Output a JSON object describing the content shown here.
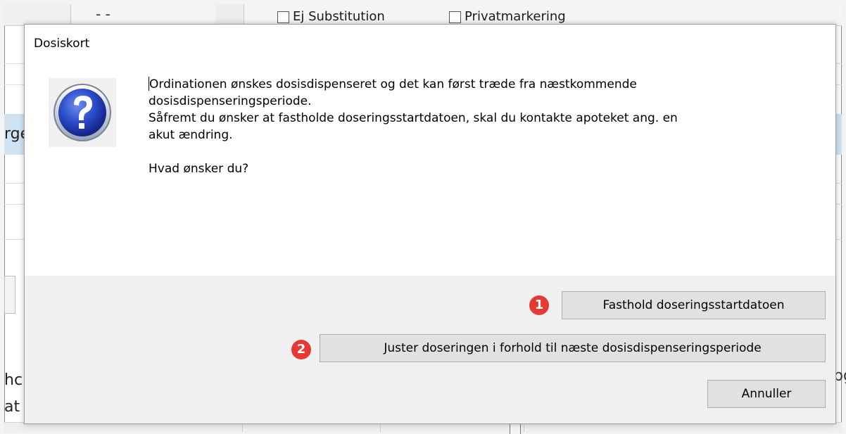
{
  "background": {
    "checkboxes": [
      {
        "label": "Ej Substitution"
      },
      {
        "label": "Privatmarkering"
      }
    ],
    "top_dash": "- -",
    "left_fragments": [
      "rge",
      "hc",
      "at"
    ],
    "right_fragment": "pg"
  },
  "dialog": {
    "title": "Dosiskort",
    "icon": "question-icon",
    "message_lines": [
      "Ordinationen ønskes dosisdispenseret og det kan først træde fra næstkommende",
      "dosisdispenseringsperiode.",
      "Såfremt du ønsker at fastholde doseringsstartdatoen, skal du kontakte apoteket ang. en",
      "akut ændring."
    ],
    "question": "Hvad ønsker du?",
    "buttons": {
      "keep_start_date": {
        "label": "Fasthold doseringsstartdatoen",
        "badge": "1"
      },
      "adjust_dosing": {
        "label": "Juster doseringen i forhold til næste dosisdispenseringsperiode",
        "badge": "2"
      },
      "cancel": {
        "label": "Annuller"
      }
    }
  },
  "colors": {
    "badge": "#e53935",
    "icon_blue": "#1f3fb5",
    "selection_row": "#cfe3f3"
  }
}
